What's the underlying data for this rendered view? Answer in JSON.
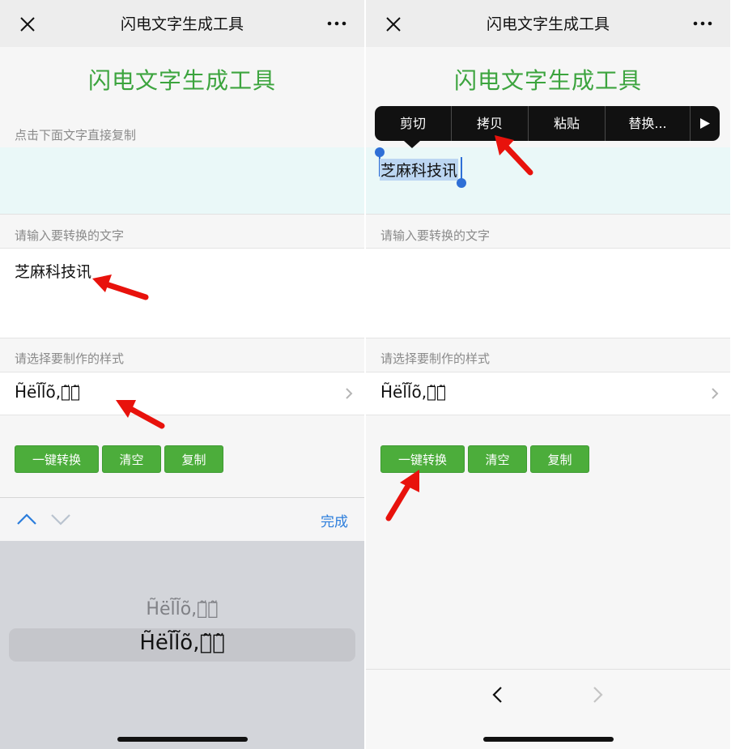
{
  "left": {
    "navbar": {
      "title": "闪电文字生成工具"
    },
    "app_title": "闪电文字生成工具",
    "output_label": "点击下面文字直接复制",
    "output_value": "",
    "input_label": "请输入要转换的文字",
    "input_value": "芝麻科技讯",
    "style_label": "请选择要制作的样式",
    "style_value": "H̃ël̃l̃õ,你̃好̃",
    "buttons": {
      "convert": "一键转换",
      "clear": "清空",
      "copy": "复制"
    },
    "keyboard": {
      "done_label": "完成",
      "picker_items": [
        "H̃ël̃l̃õ,你̃好̃",
        "H̃ël̃l̃õ,你̃好̃"
      ]
    }
  },
  "right": {
    "navbar": {
      "title": "闪电文字生成工具"
    },
    "app_title": "闪电文字生成工具",
    "context_menu": [
      "剪切",
      "拷贝",
      "粘贴",
      "替换..."
    ],
    "selected_output": "芝麻科技讯",
    "input_label": "请输入要转换的文字",
    "input_value": "",
    "style_label": "请选择要制作的样式",
    "style_value": "H̃ël̃l̃õ,你̃好̃",
    "buttons": {
      "convert": "一键转换",
      "clear": "清空",
      "copy": "复制"
    }
  },
  "colors": {
    "accent_green": "#3ca43e",
    "button_green": "#4cad3b",
    "link_blue": "#2b7ddc",
    "annotation_red": "#e8120c"
  },
  "icons": [
    "close-icon",
    "more-icon",
    "chevron-right-icon",
    "chevron-up-icon",
    "chevron-down-icon",
    "back-icon",
    "forward-icon",
    "play-triangle-icon"
  ]
}
